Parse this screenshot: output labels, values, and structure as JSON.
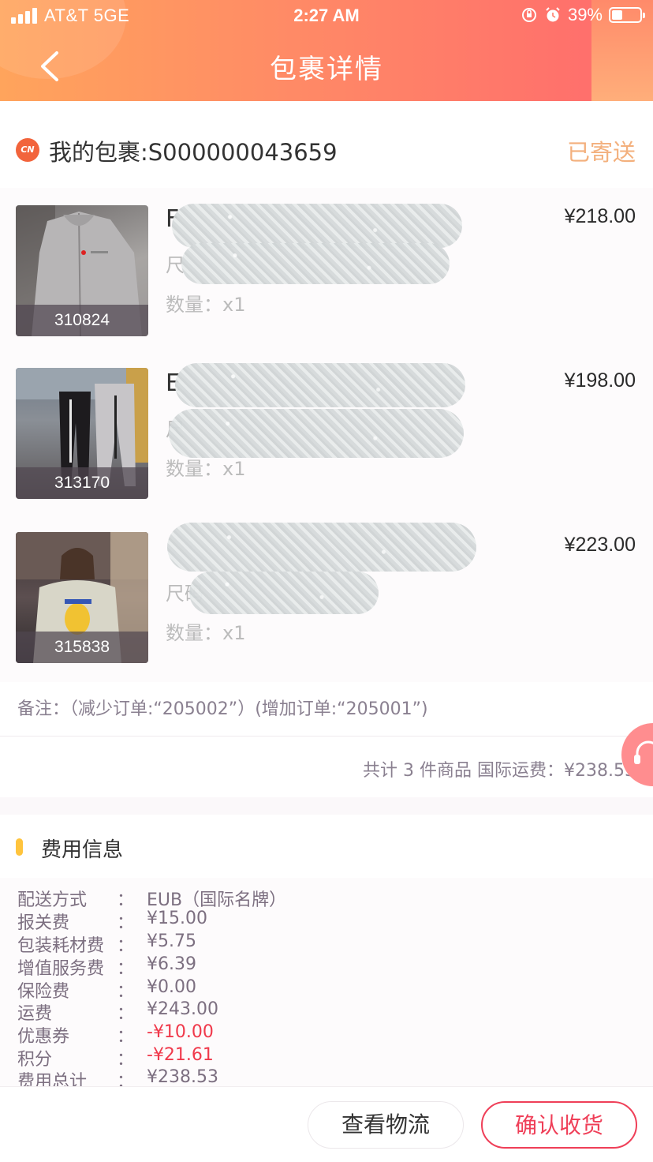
{
  "status_bar": {
    "carrier": "AT&T  5GE",
    "time": "2:27 AM",
    "battery": "39%",
    "battery_level": 0.39
  },
  "nav": {
    "title": "包裹详情"
  },
  "package": {
    "badge": "CN",
    "title": "我的包裹:S000000043659",
    "status": "已寄送"
  },
  "items": [
    {
      "code": "310824",
      "name_visible": "F",
      "size_visible": "尺",
      "qty": "数量：x1",
      "price": "¥218.00"
    },
    {
      "code": "313170",
      "name_visible": "E",
      "size_visible": "尺",
      "qty": "数量：x1",
      "price": "¥198.00"
    },
    {
      "code": "315838",
      "name_visible": "",
      "size_visible": "尺码",
      "qty": "数量：x1",
      "price": "¥223.00"
    }
  ],
  "remark": "备注：（减少订单:“205002”）(增加订单:“205001”)",
  "summary": "共计 3 件商品 国际运费：¥238.53",
  "fees": {
    "title": "费用信息",
    "rows": [
      {
        "label": "配送方式",
        "colon": "：",
        "value": "EUB（国际名牌）",
        "red": false
      },
      {
        "label": "报关费",
        "colon": "：",
        "value": "¥15.00",
        "red": false
      },
      {
        "label": "包装耗材费",
        "colon": "：",
        "value": "¥5.75",
        "red": false
      },
      {
        "label": "增值服务费",
        "colon": "：",
        "value": "¥6.39",
        "red": false
      },
      {
        "label": "保险费",
        "colon": "：",
        "value": "¥0.00",
        "red": false
      },
      {
        "label": "运费",
        "colon": "：",
        "value": "¥243.00",
        "red": false
      },
      {
        "label": "优惠券",
        "colon": "：",
        "value": "-¥10.00",
        "red": true
      },
      {
        "label": "积分",
        "colon": "：",
        "value": "-¥21.61",
        "red": true
      },
      {
        "label": "费用总计",
        "colon": "：",
        "value": "¥238.53",
        "red": false
      }
    ]
  },
  "buttons": {
    "track": "查看物流",
    "confirm": "确认收货"
  },
  "icons": {
    "back": "chevron-left-icon",
    "lock": "rotation-lock-icon",
    "alarm": "alarm-icon",
    "support": "headset-icon"
  },
  "colors": {
    "accent": "#ef3f58",
    "status": "#f3b07d",
    "header_start": "#ffa45c",
    "header_end": "#ff6a6d"
  }
}
